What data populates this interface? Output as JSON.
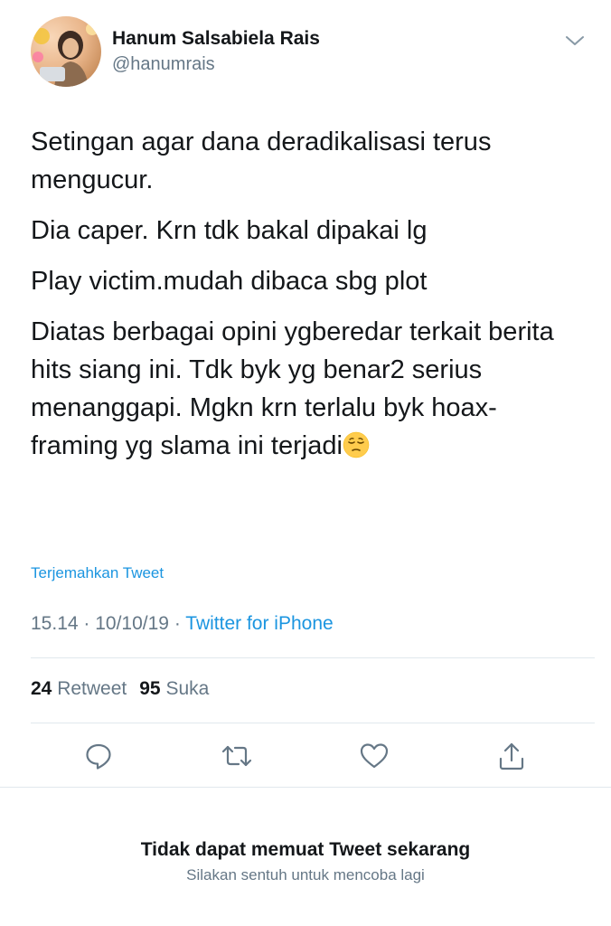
{
  "user": {
    "display_name": "Hanum Salsabiela Rais",
    "handle": "@hanumrais",
    "avatar_icon": "profile-photo",
    "menu_icon": "chevron-down-icon"
  },
  "tweet": {
    "paragraphs": [
      "Setingan agar dana deradikalisasi terus mengucur.",
      "Dia caper. Krn tdk bakal dipakai lg",
      "Play victim.mudah dibaca sbg plot"
    ],
    "last_paragraph": "Diatas berbagai opini ygberedar terkait berita hits siang ini. Tdk byk yg benar2 serius menanggapi. Mgkn krn terlalu byk hoax-framing yg slama ini terjadi",
    "last_emoji_icon": "pensive-face-emoji-icon"
  },
  "translate_link": "Terjemahkan Tweet",
  "meta": {
    "time": "15.14",
    "sep1": " · ",
    "date": "10/10/19",
    "sep2": " · ",
    "source": "Twitter for iPhone"
  },
  "stats": {
    "retweet_count": "24",
    "retweet_label": "Retweet",
    "like_count": "95",
    "like_label": "Suka"
  },
  "actions": {
    "reply_icon": "reply-icon",
    "retweet_icon": "retweet-icon",
    "like_icon": "heart-icon",
    "share_icon": "share-icon"
  },
  "error": {
    "title": "Tidak dapat memuat Tweet sekarang",
    "subtitle": "Silakan sentuh untuk mencoba lagi"
  },
  "colors": {
    "link": "#1b95e0",
    "secondary_text": "#657786",
    "primary_text": "#14171a",
    "divider": "#e1e8ed"
  }
}
